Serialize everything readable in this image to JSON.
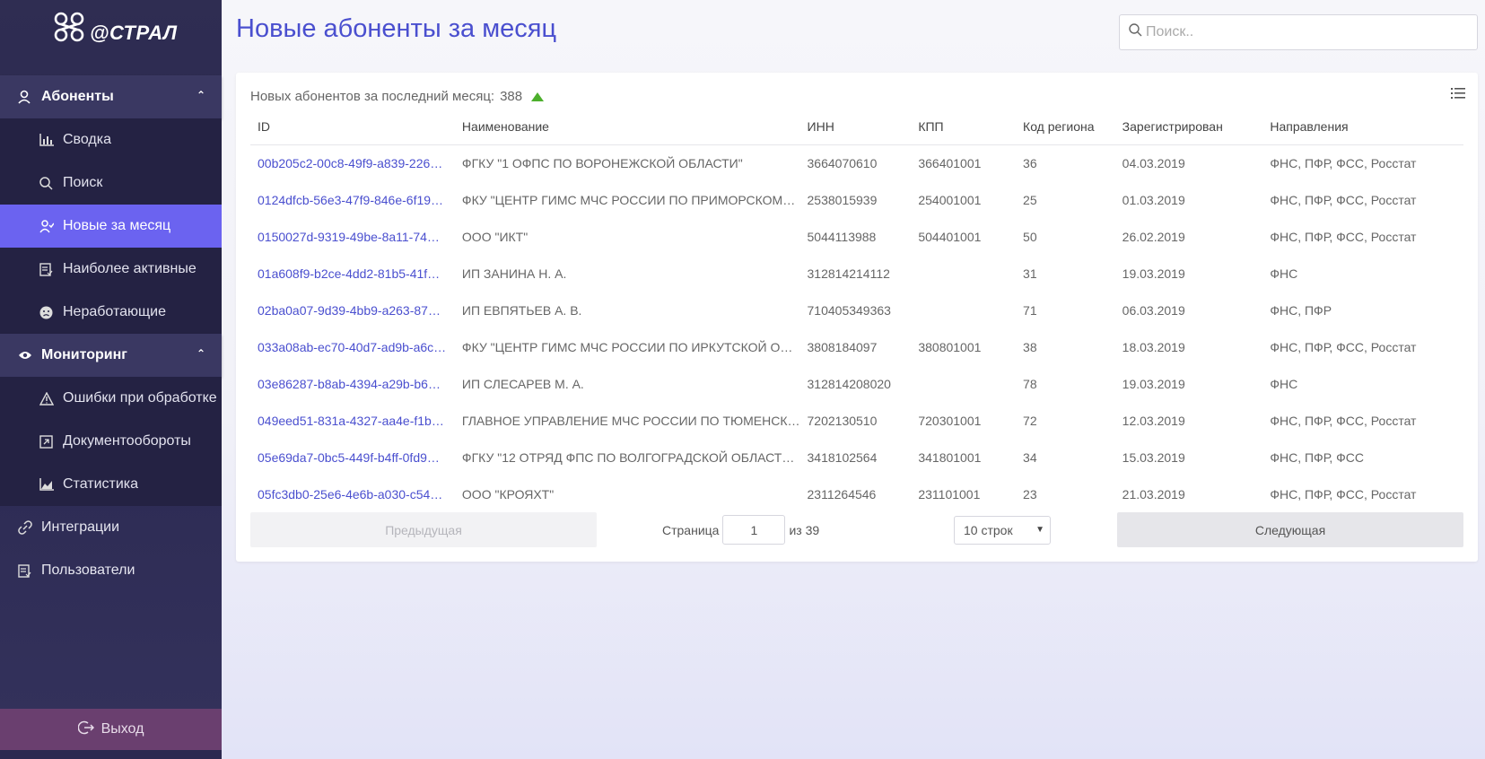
{
  "brand": {
    "name": "@СТРАЛ"
  },
  "sidebar": {
    "groups": [
      {
        "label": "Абоненты",
        "items": [
          {
            "label": "Сводка",
            "icon": "bar-chart-icon"
          },
          {
            "label": "Поиск",
            "icon": "search-icon"
          },
          {
            "label": "Новые за месяц",
            "icon": "new-users-icon",
            "active": true
          },
          {
            "label": "Наиболее активные",
            "icon": "active-users-icon"
          },
          {
            "label": "Неработающие",
            "icon": "sad-face-icon"
          }
        ]
      },
      {
        "label": "Мониторинг",
        "items": [
          {
            "label": "Ошибки при обработке",
            "icon": "warning-icon"
          },
          {
            "label": "Документообороты",
            "icon": "document-flow-icon"
          },
          {
            "label": "Статистика",
            "icon": "area-chart-icon"
          }
        ]
      }
    ],
    "top_items": [
      {
        "label": "Интеграции",
        "icon": "link-icon"
      },
      {
        "label": "Пользователи",
        "icon": "users-icon"
      }
    ],
    "logout_label": "Выход"
  },
  "header": {
    "title": "Новые абоненты за месяц",
    "search_placeholder": "Поиск.."
  },
  "summary": {
    "label": "Новых абонентов за последний месяц:",
    "count": "388"
  },
  "table": {
    "columns": [
      "ID",
      "Наименование",
      "ИНН",
      "КПП",
      "Код региона",
      "Зарегистрирован",
      "Направления"
    ],
    "rows": [
      [
        "00b205c2-00c8-49f9-a839-226…",
        "ФГКУ \"1 ОФПС ПО ВОРОНЕЖСКОЙ ОБЛАСТИ\"",
        "3664070610",
        "366401001",
        "36",
        "04.03.2019",
        "ФНС, ПФР, ФСС, Росстат"
      ],
      [
        "0124dfcb-56e3-47f9-846e-6f19…",
        "ФКУ \"ЦЕНТР ГИМС МЧС РОССИИ ПО ПРИМОРСКОМ…",
        "2538015939",
        "254001001",
        "25",
        "01.03.2019",
        "ФНС, ПФР, ФСС, Росстат"
      ],
      [
        "0150027d-9319-49be-8a11-74…",
        "ООО \"ИКТ\"",
        "5044113988",
        "504401001",
        "50",
        "26.02.2019",
        "ФНС, ПФР, ФСС, Росстат"
      ],
      [
        "01a608f9-b2ce-4dd2-81b5-41f…",
        "ИП ЗАНИНА Н. А.",
        "312814214112",
        "",
        "31",
        "19.03.2019",
        "ФНС"
      ],
      [
        "02ba0a07-9d39-4bb9-a263-87…",
        "ИП ЕВПЯТЬЕВ А. В.",
        "710405349363",
        "",
        "71",
        "06.03.2019",
        "ФНС, ПФР"
      ],
      [
        "033a08ab-ec70-40d7-ad9b-a6c…",
        "ФКУ \"ЦЕНТР ГИМС МЧС РОССИИ ПО ИРКУТСКОЙ О…",
        "3808184097",
        "380801001",
        "38",
        "18.03.2019",
        "ФНС, ПФР, ФСС, Росстат"
      ],
      [
        "03e86287-b8ab-4394-a29b-b6…",
        "ИП СЛЕСАРЕВ М. А.",
        "312814208020",
        "",
        "78",
        "19.03.2019",
        "ФНС"
      ],
      [
        "049eed51-831a-4327-aa4e-f1b…",
        "ГЛАВНОЕ УПРАВЛЕНИЕ МЧС РОССИИ ПО ТЮМЕНСК…",
        "7202130510",
        "720301001",
        "72",
        "12.03.2019",
        "ФНС, ПФР, ФСС, Росстат"
      ],
      [
        "05e69da7-0bc5-449f-b4ff-0fd9…",
        "ФГКУ \"12 ОТРЯД ФПС ПО ВОЛГОГРАДСКОЙ ОБЛАСТ…",
        "3418102564",
        "341801001",
        "34",
        "15.03.2019",
        "ФНС, ПФР, ФСС"
      ],
      [
        "05fc3db0-25e6-4e6b-a030-c54…",
        "ООО \"КРОЯХТ\"",
        "2311264546",
        "231101001",
        "23",
        "21.03.2019",
        "ФНС, ПФР, ФСС, Росстат"
      ]
    ]
  },
  "pagination": {
    "prev_label": "Предыдущая",
    "next_label": "Следующая",
    "page_label": "Страница",
    "page_value": "1",
    "total_label": "из 39",
    "rows_select": "10 строк"
  },
  "colors": {
    "accent": "#4a4fcf",
    "active_nav": "#6b63f0",
    "sidebar": "#2f2d52",
    "logout": "#6a3f6f",
    "trend_up": "#4caf2c"
  }
}
